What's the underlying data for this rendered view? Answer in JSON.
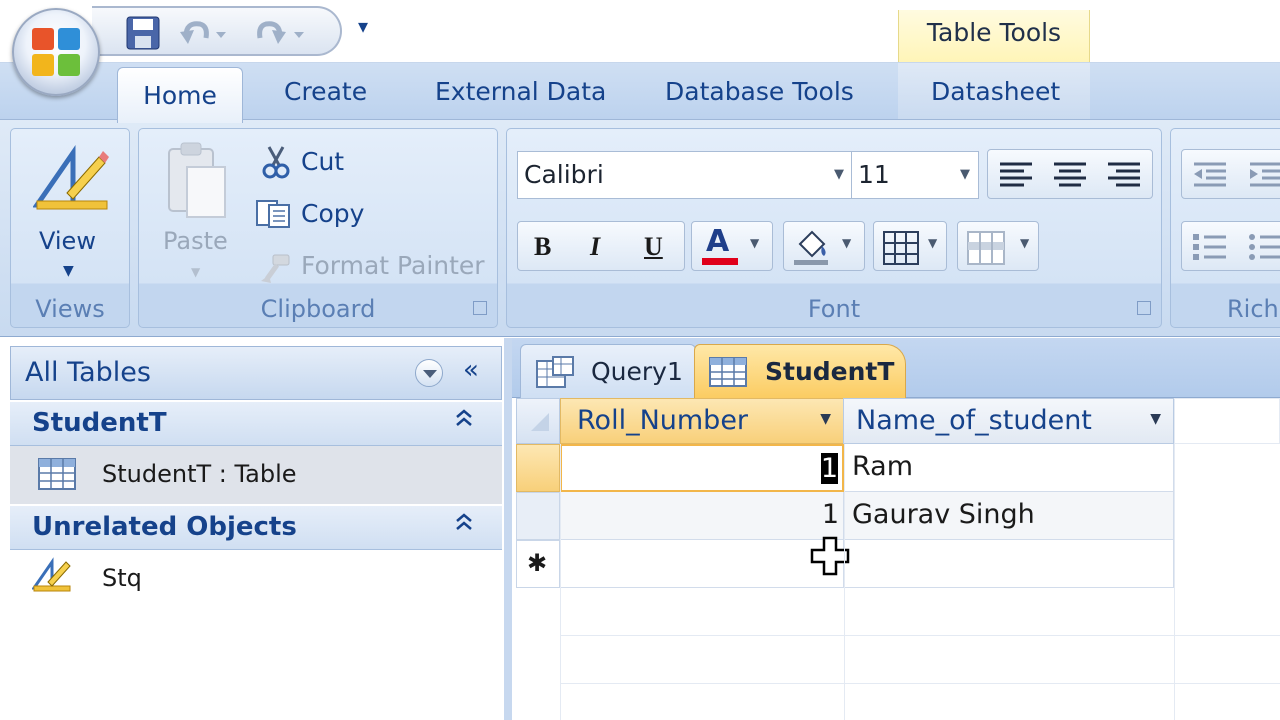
{
  "quick_access": {
    "save_icon": "save-icon",
    "undo_icon": "undo-icon",
    "redo_icon": "redo-icon",
    "customize_glyph": "▾"
  },
  "contextual": {
    "table_tools": "Table Tools"
  },
  "tabs": {
    "home": "Home",
    "create": "Create",
    "external_data": "External Data",
    "database_tools": "Database Tools",
    "datasheet": "Datasheet"
  },
  "ribbon": {
    "views": {
      "view_label": "View",
      "group_label": "Views"
    },
    "clipboard": {
      "paste_label": "Paste",
      "cut_label": "Cut",
      "copy_label": "Copy",
      "format_painter_label": "Format Painter",
      "group_label": "Clipboard"
    },
    "font": {
      "font_name": "Calibri",
      "font_size": "11",
      "bold_label": "B",
      "italic_label": "I",
      "underline_label": "U",
      "font_color_label": "A",
      "group_label": "Font"
    },
    "rich_text": {
      "group_label": "Rich"
    }
  },
  "colors": {
    "accent": "#15428b",
    "font_color_bar": "#e0001a",
    "active_tab": "#fbcc62"
  },
  "nav_pane": {
    "title": "All Tables",
    "collapse_glyph": "«",
    "groups": [
      {
        "label": "StudentT",
        "chevron": "≈",
        "items": [
          {
            "label": "StudentT : Table"
          }
        ]
      },
      {
        "label": "Unrelated Objects",
        "chevron": "≈",
        "items": [
          {
            "label": "Stq"
          }
        ]
      }
    ]
  },
  "doc_tabs": [
    {
      "label": "Query1"
    },
    {
      "label": "StudentT"
    }
  ],
  "datasheet": {
    "columns": [
      "Roll_Number",
      "Name_of_student"
    ],
    "rows": [
      {
        "roll": "1",
        "name": "Ram"
      },
      {
        "roll": "1",
        "name": "Gaurav Singh"
      }
    ],
    "new_row_marker": "✱"
  }
}
